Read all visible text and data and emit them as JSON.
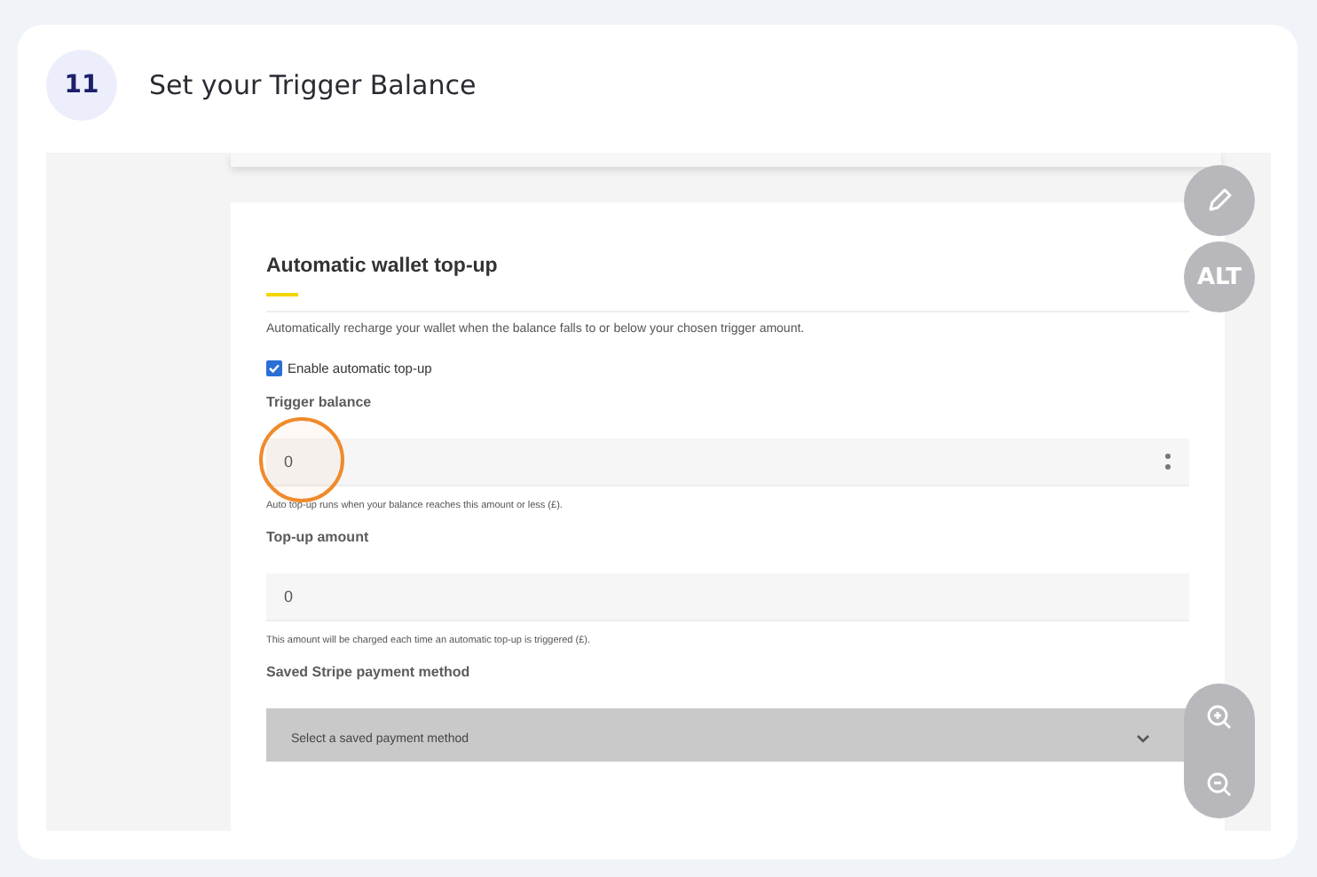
{
  "step": {
    "number": "11",
    "title": "Set your Trigger Balance"
  },
  "screenshot": {
    "heading": "Automatic wallet top-up",
    "description": "Automatically recharge your wallet when the balance falls to or below your chosen trigger amount.",
    "enable": {
      "label": "Enable automatic top-up",
      "checked": true
    },
    "fields": [
      {
        "kind": "number",
        "label": "Trigger balance",
        "value": "0",
        "help": "Auto top-up runs when your balance reaches this amount or less (£).",
        "highlighted": true
      },
      {
        "kind": "text",
        "label": "Top-up amount",
        "value": "0",
        "help": "This amount will be charged each time an automatic top-up is triggered (£).",
        "highlighted": false
      },
      {
        "kind": "select",
        "label": "Saved Stripe payment method",
        "value": "Select a saved payment method",
        "highlighted": false
      }
    ]
  },
  "controls": {
    "alt_label": "ALT"
  }
}
